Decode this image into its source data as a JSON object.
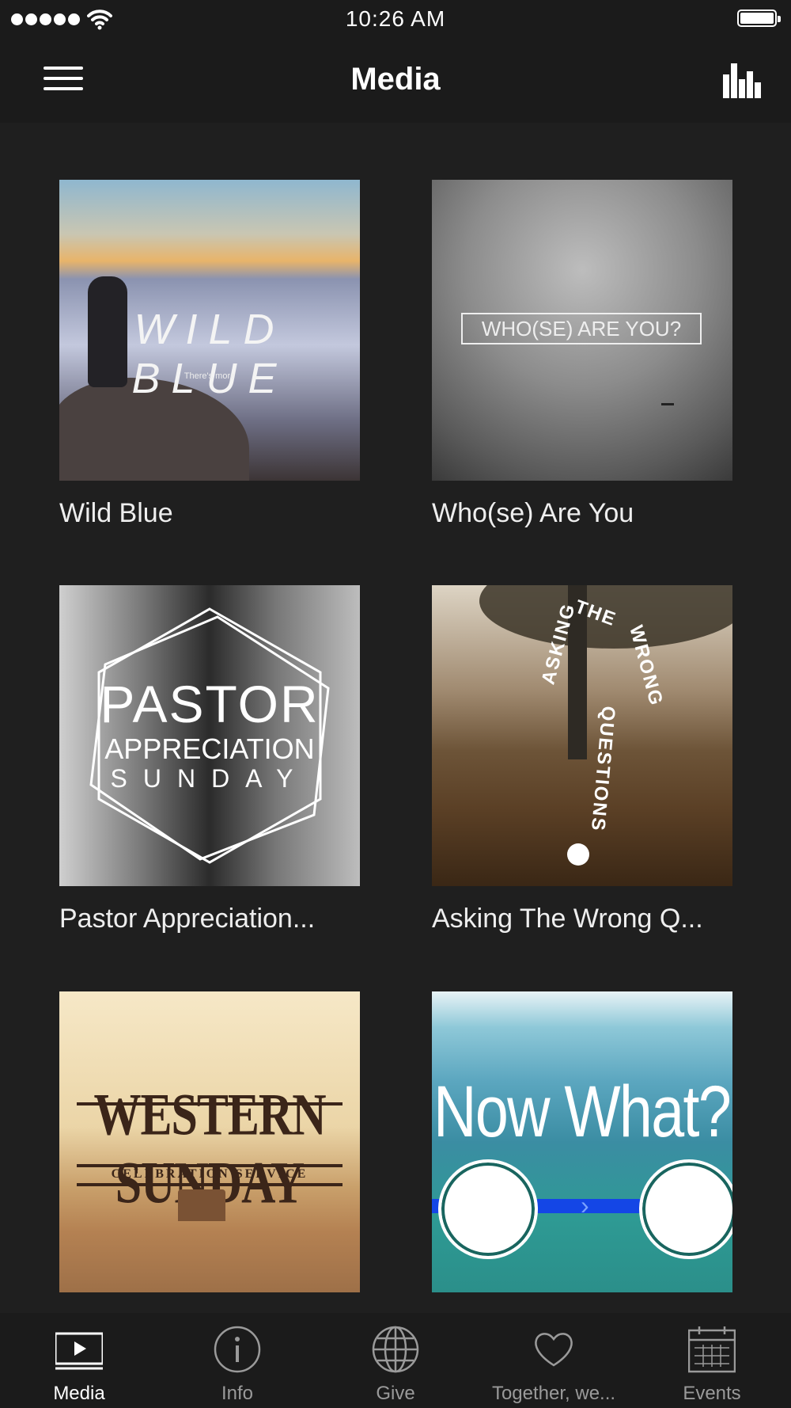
{
  "status_bar": {
    "time": "10:26 AM",
    "signal_dots": 5
  },
  "nav": {
    "title": "Media",
    "menu_icon": "hamburger-icon",
    "stats_icon": "bar-chart-icon"
  },
  "media_items": [
    {
      "label": "Wild Blue",
      "art_title": "WILD BLUE",
      "art_subtitle": "There's more"
    },
    {
      "label": "Who(se) Are You",
      "art_title": "WHO(SE) ARE YOU?"
    },
    {
      "label": "Pastor Appreciation...",
      "art_title_1": "PASTOR",
      "art_title_2": "APPRECIATION",
      "art_title_3": "SUNDAY"
    },
    {
      "label": "Asking The Wrong Q...",
      "art_words": [
        "ASKING",
        "THE",
        "WRONG",
        "QUESTIONS"
      ]
    },
    {
      "label": "",
      "art_title": "WESTERN SUNDAY",
      "art_subtitle": "CELEBRATION SERVICE"
    },
    {
      "label": "",
      "art_title": "Now What?"
    }
  ],
  "tabs": [
    {
      "label": "Media",
      "icon": "play-screen-icon",
      "active": true
    },
    {
      "label": "Info",
      "icon": "info-icon",
      "active": false
    },
    {
      "label": "Give",
      "icon": "globe-icon",
      "active": false
    },
    {
      "label": "Together, we...",
      "icon": "heart-icon",
      "active": false
    },
    {
      "label": "Events",
      "icon": "calendar-icon",
      "active": false
    }
  ],
  "colors": {
    "background": "#1f1f1f",
    "bar": "#1b1b1b",
    "tab_inactive": "#9a9a9a",
    "tab_active": "#ffffff"
  }
}
